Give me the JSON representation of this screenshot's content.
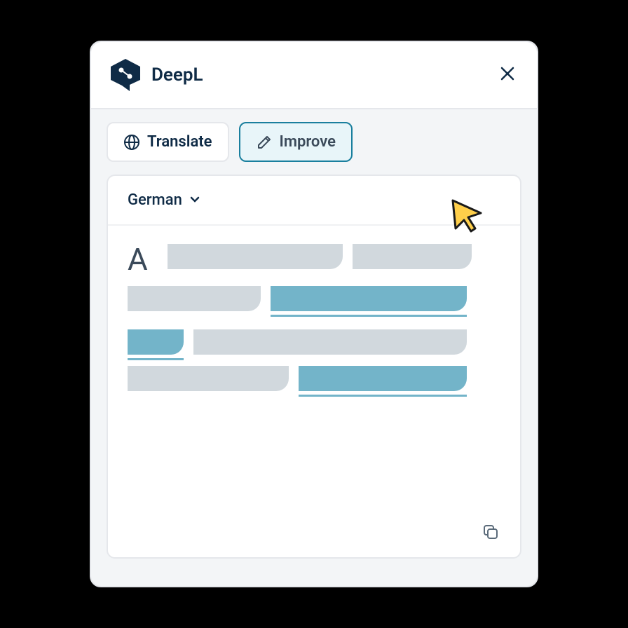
{
  "header": {
    "brand": "DeepL"
  },
  "tabs": {
    "translate": "Translate",
    "improve": "Improve"
  },
  "language": {
    "selected": "German"
  },
  "placeholder_glyph": "A",
  "colors": {
    "brand_dark": "#0f2b46",
    "accent_teal": "#1a7f9e",
    "tab_active_bg": "#e8f5f9",
    "placeholder_gray": "#d1d8dd",
    "placeholder_blue": "#73b4c9",
    "cursor_fill": "#ffcf4a"
  }
}
